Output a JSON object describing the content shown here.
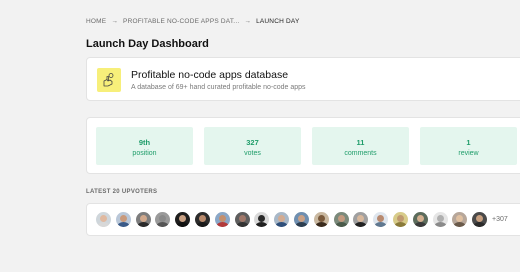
{
  "breadcrumb": {
    "home": "HOME",
    "separator": "→",
    "product": "PROFITABLE NO-CODE APPS DAT...",
    "current": "LAUNCH DAY"
  },
  "page": {
    "title": "Launch Day Dashboard"
  },
  "product": {
    "name": "Profitable no-code apps database",
    "description": "A database of 69+ hand curated profitable no-code apps",
    "thumbnail_icon": "hand-coin-icon",
    "thumbnail_color": "#f7ef7a"
  },
  "stats": [
    {
      "value": "9th",
      "label": "position"
    },
    {
      "value": "327",
      "label": "votes"
    },
    {
      "value": "11",
      "label": "comments"
    },
    {
      "value": "1",
      "label": "review"
    }
  ],
  "stats_colors": {
    "background": "#e4f6ee",
    "text": "#1f9d6a"
  },
  "upvoters": {
    "section_label": "LATEST 20 UPVOTERS",
    "more_count": "+307",
    "avatar_icon": "user-avatar-icon",
    "avatars": [
      {
        "bg": "#cfd6db",
        "skin": "#e0b9a0",
        "shirt": "#d8d8d8"
      },
      {
        "bg": "#b9c7d8",
        "skin": "#c99a7c",
        "shirt": "#3a5a88"
      },
      {
        "bg": "#7d7d7d",
        "skin": "#d0a88c",
        "shirt": "#2a2a2a"
      },
      {
        "bg": "#9a9a9a",
        "skin": "#8a8a8a",
        "shirt": "#555555"
      },
      {
        "bg": "#1e1e1e",
        "skin": "#c9a184",
        "shirt": "#111111"
      },
      {
        "bg": "#2c2c2c",
        "skin": "#b98a6c",
        "shirt": "#1a1a1a"
      },
      {
        "bg": "#8aa7c7",
        "skin": "#c4906f",
        "shirt": "#b33a3a"
      },
      {
        "bg": "#5e5e5e",
        "skin": "#a0786a",
        "shirt": "#333333"
      },
      {
        "bg": "#d9d9d9",
        "skin": "#2a2a2a",
        "shirt": "#202020"
      },
      {
        "bg": "#a8b8c8",
        "skin": "#d2ab92",
        "shirt": "#2f4f7a"
      },
      {
        "bg": "#6f8fb0",
        "skin": "#caa186",
        "shirt": "#2c3e50"
      },
      {
        "bg": "#c9b8a0",
        "skin": "#7a5a3c",
        "shirt": "#3a2a1c"
      },
      {
        "bg": "#7b8a7b",
        "skin": "#c39a7f",
        "shirt": "#4a5a4a"
      },
      {
        "bg": "#a0a0a0",
        "skin": "#d8b89c",
        "shirt": "#222222"
      },
      {
        "bg": "#dfe6ee",
        "skin": "#b88a70",
        "shirt": "#607890"
      },
      {
        "bg": "#d8cc8a",
        "skin": "#c09a70",
        "shirt": "#8a7a3a"
      },
      {
        "bg": "#5c6c5c",
        "skin": "#d4b090",
        "shirt": "#3a3a3a"
      },
      {
        "bg": "#e6e6e6",
        "skin": "#b0b0b0",
        "shirt": "#8a8a8a"
      },
      {
        "bg": "#b7a79a",
        "skin": "#e0c0a0",
        "shirt": "#6a5a4a"
      },
      {
        "bg": "#4a4a4a",
        "skin": "#c8a080",
        "shirt": "#2a2a2a"
      }
    ]
  }
}
